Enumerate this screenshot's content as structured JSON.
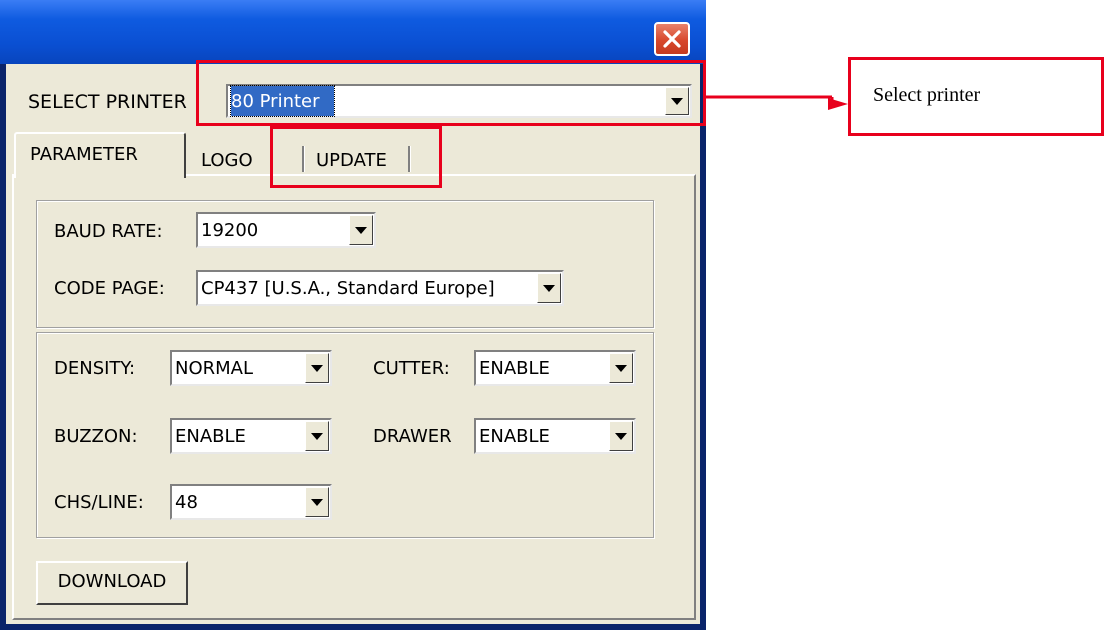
{
  "dialog": {
    "select_printer_label": "SELECT PRINTER",
    "printer_value": "80 Printer",
    "tabs": [
      {
        "label": "PARAMETER",
        "active": true
      },
      {
        "label": "LOGO",
        "active": false
      },
      {
        "label": "UPDATE",
        "active": false
      }
    ],
    "comm": {
      "baud_rate_label": "BAUD RATE:",
      "baud_rate_value": "19200",
      "code_page_label": "CODE PAGE:",
      "code_page_value": "CP437 [U.S.A., Standard Europe]"
    },
    "settings": {
      "density_label": "DENSITY:",
      "density_value": "NORMAL",
      "cutter_label": "CUTTER:",
      "cutter_value": "ENABLE",
      "buzzon_label": "BUZZON:",
      "buzzon_value": "ENABLE",
      "drawer_label": "DRAWER",
      "drawer_value": "ENABLE",
      "chs_line_label": "CHS/LINE:",
      "chs_line_value": "48"
    },
    "download_label": "DOWNLOAD"
  },
  "annotation": {
    "callout_text": "Select printer",
    "highlight_color": "#e8001c"
  },
  "icons": {
    "close": "close-icon",
    "dropdown": "chevron-down-icon",
    "arrow": "arrow-right-icon"
  }
}
